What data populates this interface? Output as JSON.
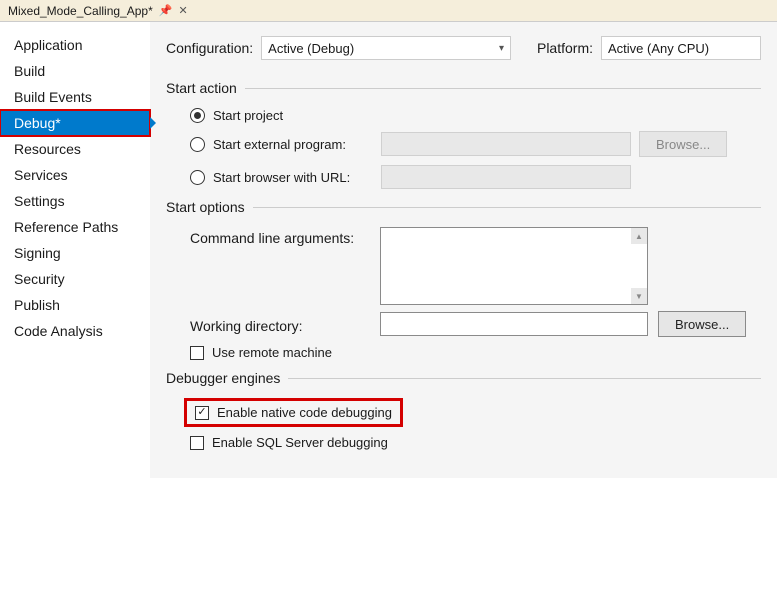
{
  "tab": {
    "title": "Mixed_Mode_Calling_App*"
  },
  "sidebar": {
    "items": [
      {
        "label": "Application"
      },
      {
        "label": "Build"
      },
      {
        "label": "Build Events"
      },
      {
        "label": "Debug*"
      },
      {
        "label": "Resources"
      },
      {
        "label": "Services"
      },
      {
        "label": "Settings"
      },
      {
        "label": "Reference Paths"
      },
      {
        "label": "Signing"
      },
      {
        "label": "Security"
      },
      {
        "label": "Publish"
      },
      {
        "label": "Code Analysis"
      }
    ],
    "active_index": 3
  },
  "top": {
    "configuration_label": "Configuration:",
    "configuration_value": "Active (Debug)",
    "platform_label": "Platform:",
    "platform_value": "Active (Any CPU)"
  },
  "sections": {
    "start_action": {
      "title": "Start action",
      "start_project": "Start project",
      "start_external": "Start external program:",
      "start_browser": "Start browser with URL:",
      "browse": "Browse..."
    },
    "start_options": {
      "title": "Start options",
      "cmd_args": "Command line arguments:",
      "working_dir": "Working directory:",
      "browse": "Browse...",
      "use_remote": "Use remote machine"
    },
    "debugger": {
      "title": "Debugger engines",
      "native": "Enable native code debugging",
      "sql": "Enable SQL Server debugging"
    }
  }
}
